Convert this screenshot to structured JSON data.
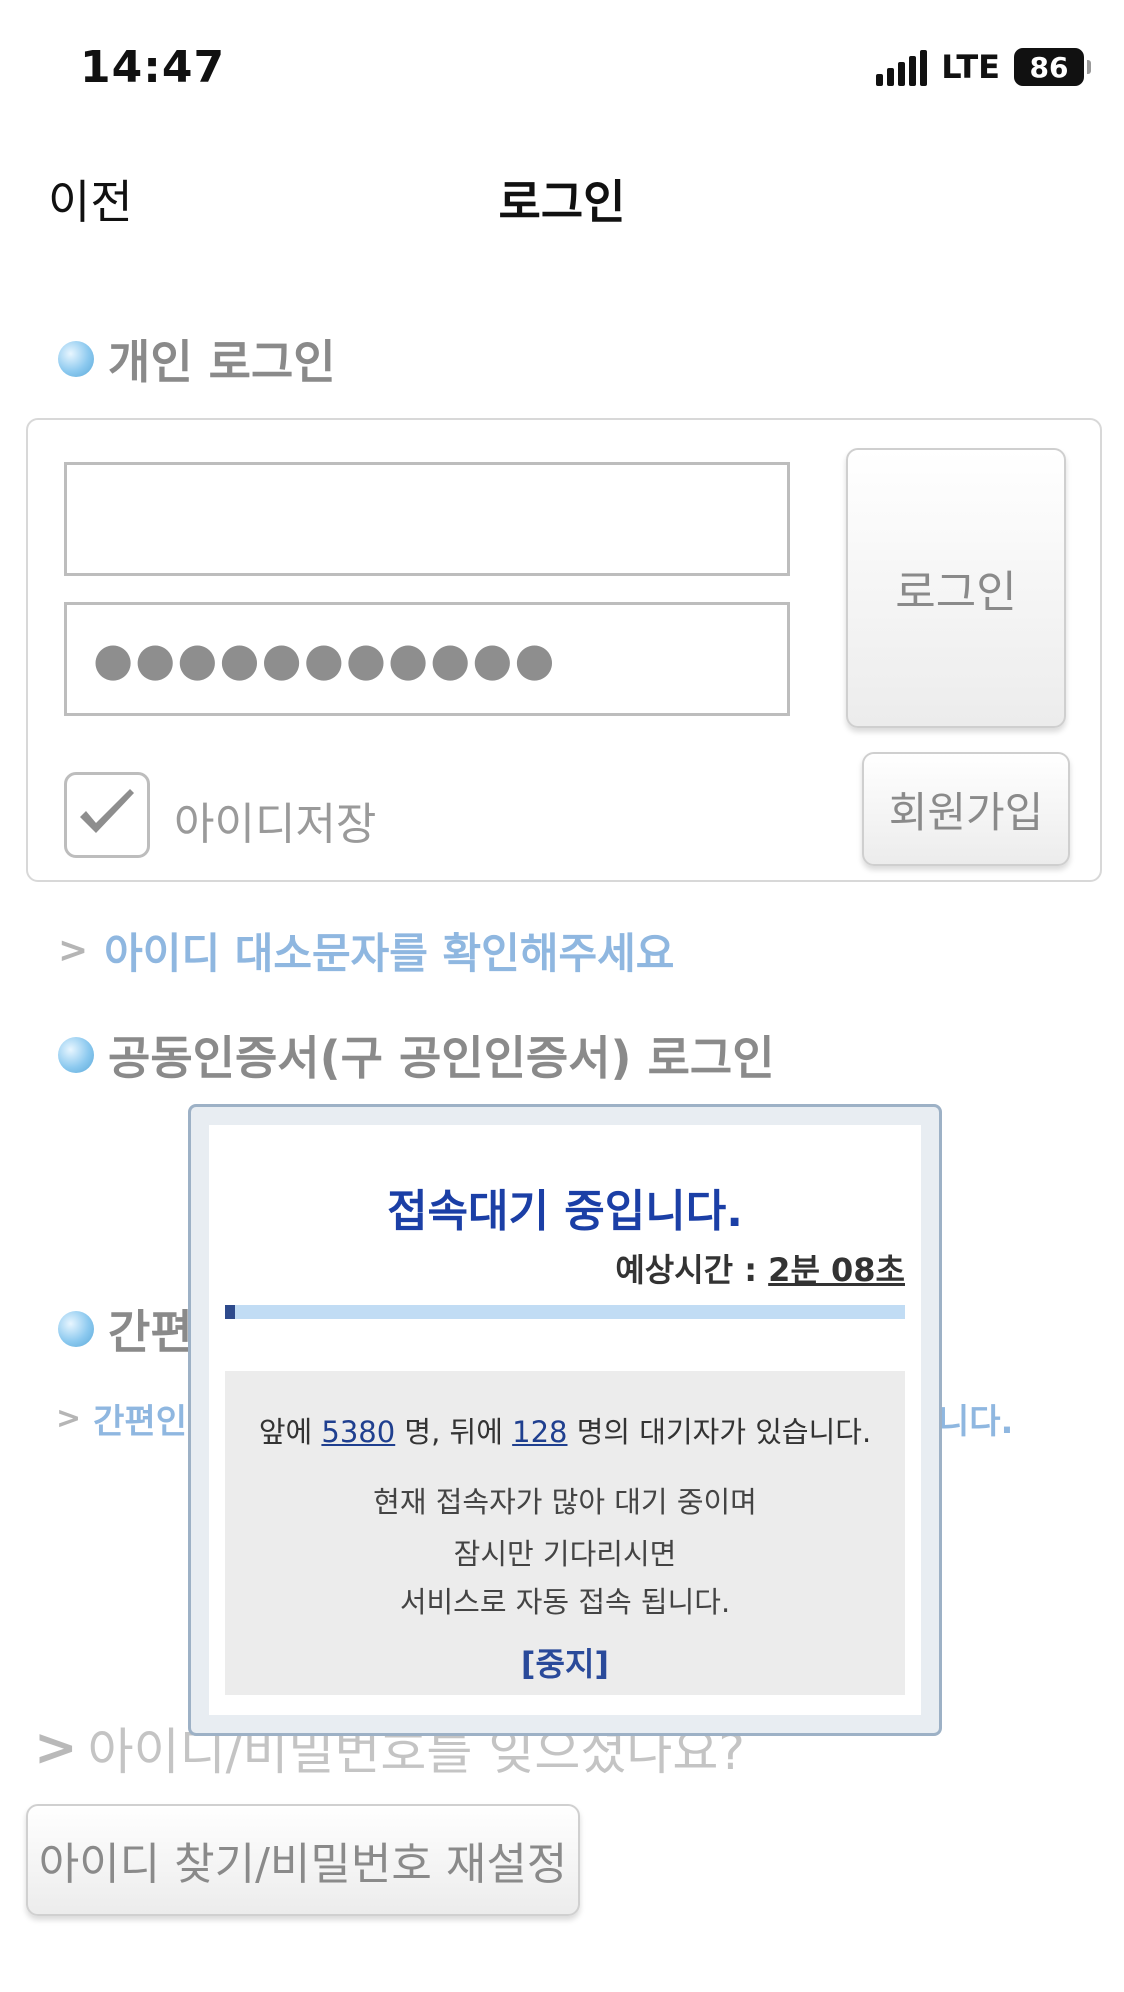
{
  "status_bar": {
    "time": "14:47",
    "network": "LTE",
    "battery": "86"
  },
  "nav": {
    "back": "이전",
    "title": "로그인"
  },
  "personal_login": {
    "heading": "개인 로그인",
    "id_value": "",
    "password_mask": "●●●●●●●●●●●",
    "login_button": "로그인",
    "save_id_label": "아이디저장",
    "save_id_checked": true,
    "join_button": "회원가입"
  },
  "case_hint": "아이디 대소문자를 확인해주세요",
  "cert_login": {
    "heading": "공동인증서(구 공인인증서) 로그인"
  },
  "simple_login": {
    "heading_partial": "간편",
    "hint_partial": "간편인",
    "hint_tail": "니다."
  },
  "forgot": {
    "text": "아이디/비밀번호를 잊으셨나요?",
    "find_button": "아이디 찾기/비밀번호 재설정"
  },
  "queue_modal": {
    "title": "접속대기 중입니다.",
    "eta_label": "예상시간 : ",
    "eta_value": "2분 08초",
    "progress": 0.015,
    "ahead_prefix": "앞에 ",
    "ahead_count": "5380",
    "ahead_mid": " 명, 뒤에 ",
    "behind_count": "128",
    "behind_suffix": " 명의 대기자가 있습니다.",
    "message_1": "현재 접속자가 많아 대기 중이며",
    "message_2": "잠시만 기다리시면",
    "message_3": "서비스로 자동 접속 됩니다.",
    "stop_button": "[중지]"
  },
  "colors": {
    "modal_title": "#1b3fa6",
    "hint": "#8fb7e0",
    "progress_track": "#c1dcf4",
    "progress_fill": "#2e4a8c"
  }
}
